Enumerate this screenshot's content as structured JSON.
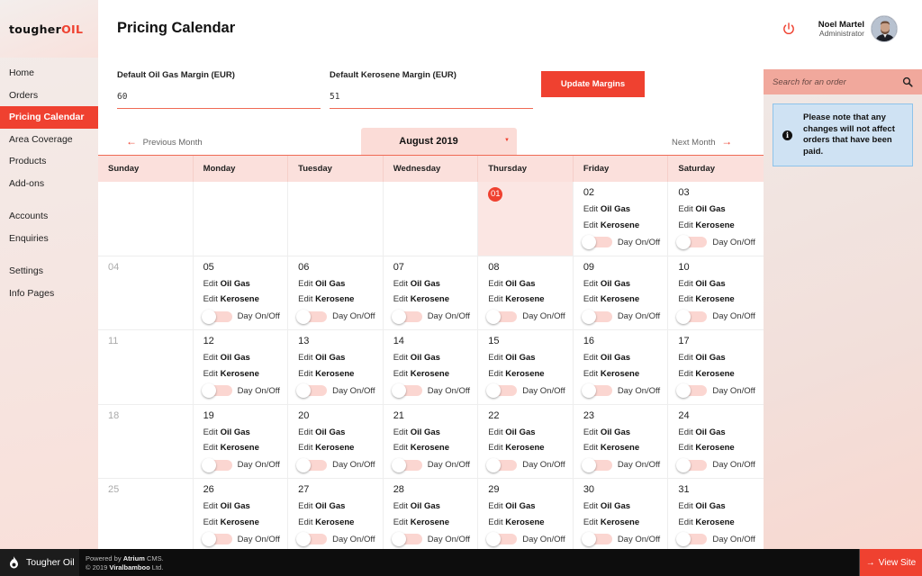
{
  "brand": {
    "logo_main": "tougher",
    "logo_accent": "OIL",
    "footer_name": "Tougher Oil",
    "accent_color": "#ef4130"
  },
  "sidebar": {
    "groups": [
      [
        {
          "label": "Home"
        },
        {
          "label": "Orders"
        },
        {
          "label": "Pricing Calendar",
          "active": true
        },
        {
          "label": "Area Coverage"
        },
        {
          "label": "Products"
        },
        {
          "label": "Add-ons"
        }
      ],
      [
        {
          "label": "Accounts"
        },
        {
          "label": "Enquiries"
        }
      ],
      [
        {
          "label": "Settings"
        },
        {
          "label": "Info Pages"
        }
      ]
    ]
  },
  "header": {
    "title": "Pricing Calendar",
    "user": {
      "name": "Noel Martel",
      "role": "Administrator"
    },
    "icons": {
      "logout": "power-icon",
      "avatar": "user-avatar"
    }
  },
  "margins": {
    "oil": {
      "label": "Default Oil Gas Margin (EUR)",
      "value": "60"
    },
    "kerosene": {
      "label": "Default Kerosene Margin (EUR)",
      "value": "51"
    },
    "update_label": "Update Margins"
  },
  "month_nav": {
    "prev_label": "Previous Month",
    "next_label": "Next Month",
    "current": "August 2019"
  },
  "calendar": {
    "weekdays": [
      "Sunday",
      "Monday",
      "Tuesday",
      "Wednesday",
      "Thursday",
      "Friday",
      "Saturday"
    ],
    "edit_prefix": "Edit",
    "oil_label": "Oil Gas",
    "kerosene_label": "Kerosene",
    "toggle_label": "Day On/Off",
    "weeks": [
      [
        {
          "day": ""
        },
        {
          "day": ""
        },
        {
          "day": ""
        },
        {
          "day": ""
        },
        {
          "day": "01",
          "today": true
        },
        {
          "day": "02",
          "editable": true
        },
        {
          "day": "03",
          "editable": true
        }
      ],
      [
        {
          "day": "04",
          "muted": true
        },
        {
          "day": "05",
          "editable": true
        },
        {
          "day": "06",
          "editable": true
        },
        {
          "day": "07",
          "editable": true
        },
        {
          "day": "08",
          "editable": true
        },
        {
          "day": "09",
          "editable": true
        },
        {
          "day": "10",
          "editable": true
        }
      ],
      [
        {
          "day": "11",
          "muted": true
        },
        {
          "day": "12",
          "editable": true
        },
        {
          "day": "13",
          "editable": true
        },
        {
          "day": "14",
          "editable": true
        },
        {
          "day": "15",
          "editable": true
        },
        {
          "day": "16",
          "editable": true
        },
        {
          "day": "17",
          "editable": true
        }
      ],
      [
        {
          "day": "18",
          "muted": true
        },
        {
          "day": "19",
          "editable": true
        },
        {
          "day": "20",
          "editable": true
        },
        {
          "day": "21",
          "editable": true
        },
        {
          "day": "22",
          "editable": true
        },
        {
          "day": "23",
          "editable": true
        },
        {
          "day": "24",
          "editable": true
        }
      ],
      [
        {
          "day": "25",
          "muted": true
        },
        {
          "day": "26",
          "editable": true
        },
        {
          "day": "27",
          "editable": true
        },
        {
          "day": "28",
          "editable": true
        },
        {
          "day": "29",
          "editable": true
        },
        {
          "day": "30",
          "editable": true
        },
        {
          "day": "31",
          "editable": true
        }
      ]
    ]
  },
  "right_panel": {
    "search_placeholder": "Search for an order",
    "notice": "Please note that any changes will not affect orders that have been paid."
  },
  "footer": {
    "powered_prefix": "Powered by",
    "cms_name": "Atrium",
    "cms_suffix": "CMS.",
    "copyright_prefix": "© 2019",
    "company": "Viralbamboo",
    "company_suffix": "Ltd.",
    "view_site_label": "View Site"
  }
}
